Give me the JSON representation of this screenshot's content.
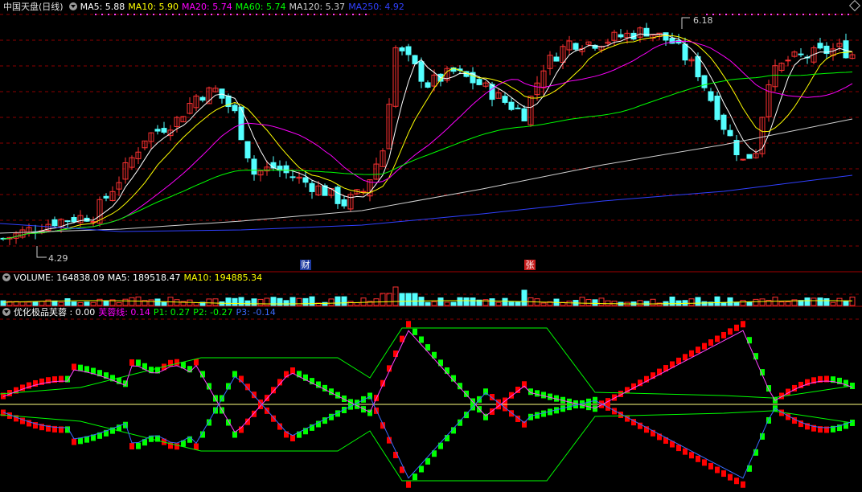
{
  "main_header": {
    "title": "中国天盘(日线)",
    "ma": [
      {
        "label": "MA5: 5.88",
        "color": "#ffffff"
      },
      {
        "label": "MA10: 5.90",
        "color": "#ffff00"
      },
      {
        "label": "MA20: 5.74",
        "color": "#ff00ff"
      },
      {
        "label": "MA60: 5.74",
        "color": "#00ff00"
      },
      {
        "label": "MA120: 5.37",
        "color": "#d0d0d0"
      },
      {
        "label": "MA250: 4.92",
        "color": "#3040ff"
      }
    ]
  },
  "volume_header": [
    {
      "label": "VOLUME: 164838.09",
      "color": "#ffffff"
    },
    {
      "label": "MA5: 189518.47",
      "color": "#ffffff"
    },
    {
      "label": "MA10: 194885.34",
      "color": "#ffff00"
    }
  ],
  "indicator_header": [
    {
      "label": "优化极品芙蓉 : 0.00",
      "color": "#ffffff"
    },
    {
      "label": "芙蓉线: 0.14",
      "color": "#ff00ff"
    },
    {
      "label": "P1: 0.27",
      "color": "#00ff00"
    },
    {
      "label": "P2: -0.27",
      "color": "#00ff00"
    },
    {
      "label": "P3: -0.14",
      "color": "#3a6bff"
    }
  ],
  "annotations": {
    "high": "6.18",
    "low": "4.29",
    "event_cai": "财",
    "event_zhang": "张"
  },
  "colors": {
    "up": "#ff3232",
    "down": "#54ffff",
    "grid": "#8b0000",
    "green": "#00ff00",
    "red": "#ff0000"
  },
  "chart_data": {
    "type": "candlestick",
    "series_note": "price bars",
    "high": 6.18,
    "low": 4.29,
    "ma_current": {
      "MA5": 5.88,
      "MA10": 5.9,
      "MA20": 5.74,
      "MA60": 5.74,
      "MA120": 5.37,
      "MA250": 4.92
    },
    "volume": 164838.09,
    "volume_ma5": 189518.47,
    "volume_ma10": 194885.34,
    "indicator": {
      "value": 0.0,
      "furong": 0.14,
      "P1": 0.27,
      "P2": -0.27,
      "P3": -0.14
    }
  }
}
